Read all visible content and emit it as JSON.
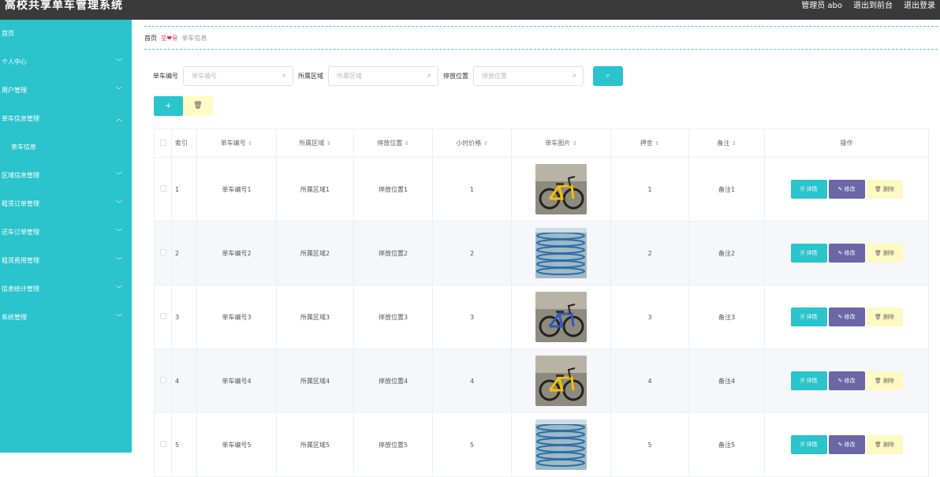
{
  "header": {
    "title": "高校共享单车管理系统",
    "admin": "管理员 abo",
    "to_front": "退出到前台",
    "logout": "退出登录"
  },
  "sidebar": {
    "items": [
      {
        "label": "首页",
        "arrow": ""
      },
      {
        "label": "个人中心",
        "arrow": "﹀"
      },
      {
        "label": "用户管理",
        "arrow": "﹀"
      },
      {
        "label": "单车信息管理",
        "arrow": "︿"
      },
      {
        "label": "单车信息",
        "arrow": ""
      },
      {
        "label": "区域信息管理",
        "arrow": "﹀"
      },
      {
        "label": "租赁订单管理",
        "arrow": "﹀"
      },
      {
        "label": "还车订单管理",
        "arrow": "﹀"
      },
      {
        "label": "租赁费用管理",
        "arrow": "﹀"
      },
      {
        "label": "信息统计管理",
        "arrow": "﹀"
      },
      {
        "label": "系统管理",
        "arrow": "﹀"
      }
    ]
  },
  "breadcrumb": {
    "home": "首页",
    "deco": "웃❤유",
    "current": "单车信息"
  },
  "search": {
    "bike_no_label": "单车编号",
    "bike_no_placeholder": "单车编号",
    "area_label": "所属区域",
    "area_placeholder": "所属区域",
    "location_label": "停放位置",
    "location_placeholder": "停放位置",
    "search_icon": "search-icon"
  },
  "actions": {
    "add_label": "+",
    "delete_label": "🗑"
  },
  "table": {
    "headers": [
      "索引",
      "单车编号",
      "所属区域",
      "停放位置",
      "小时价格",
      "单车图片",
      "押金",
      "备注",
      "操作"
    ],
    "sort_glyph": "⇕",
    "rows": [
      {
        "index": "1",
        "bike_no": "单车编号1",
        "area": "所属区域1",
        "location": "停放位置1",
        "price": "1",
        "deposit": "1",
        "remark": "备注1",
        "image": "yellow-bike"
      },
      {
        "index": "2",
        "bike_no": "单车编号2",
        "area": "所属区域2",
        "location": "停放位置2",
        "price": "2",
        "deposit": "2",
        "remark": "备注2",
        "image": "bike-row"
      },
      {
        "index": "3",
        "bike_no": "单车编号3",
        "area": "所属区域3",
        "location": "停放位置3",
        "price": "3",
        "deposit": "3",
        "remark": "备注3",
        "image": "blue-yellow-bike"
      },
      {
        "index": "4",
        "bike_no": "单车编号4",
        "area": "所属区域4",
        "location": "停放位置4",
        "price": "4",
        "deposit": "4",
        "remark": "备注4",
        "image": "yellow-bike-street"
      },
      {
        "index": "5",
        "bike_no": "单车编号5",
        "area": "所属区域5",
        "location": "停放位置5",
        "price": "5",
        "deposit": "5",
        "remark": "备注5",
        "image": "bike-row"
      }
    ],
    "ops": {
      "detail": "🗎 详情",
      "edit": "✎ 修改",
      "delete": "🗑 删除"
    }
  },
  "colors": {
    "accent": "#2bc3cc",
    "header_bg": "#3a3a3a",
    "edit_btn": "#6b66a6",
    "delete_btn": "#fff9c2"
  }
}
